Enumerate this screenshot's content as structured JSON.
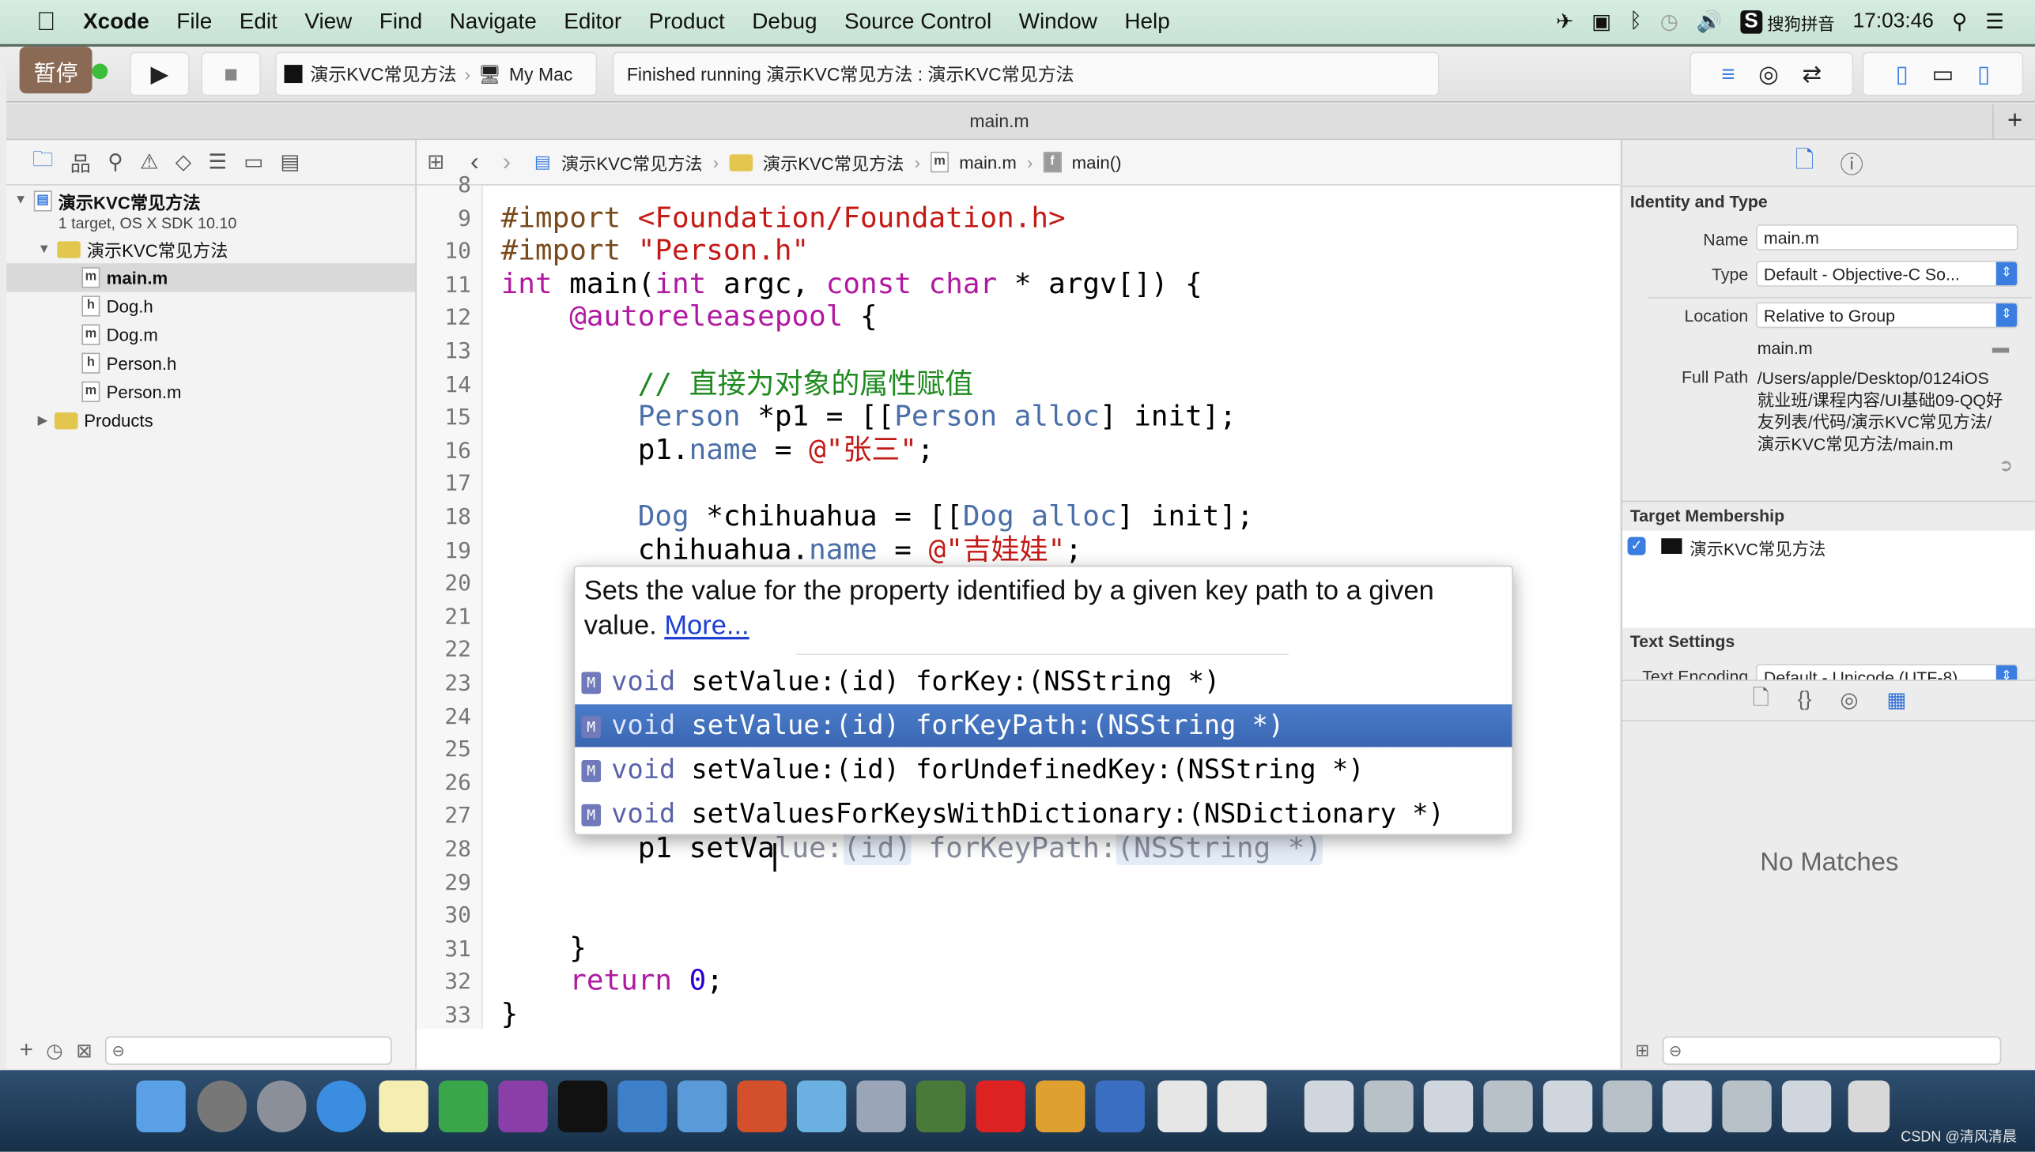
{
  "menubar": {
    "apple": "",
    "items": [
      "Xcode",
      "File",
      "Edit",
      "View",
      "Find",
      "Navigate",
      "Editor",
      "Product",
      "Debug",
      "Source Control",
      "Window",
      "Help"
    ],
    "input_method": "搜狗拼音",
    "clock": "17:03:46"
  },
  "toolbar": {
    "pause_label": "暂停",
    "scheme": "演示KVC常见方法",
    "destination": "My Mac",
    "status": "Finished running 演示KVC常见方法 : 演示KVC常见方法"
  },
  "tab": {
    "title": "main.m",
    "add": "+"
  },
  "navigator": {
    "project": {
      "name": "演示KVC常见方法",
      "subtitle": "1 target, OS X SDK 10.10"
    },
    "group": "演示KVC常见方法",
    "files": [
      {
        "badge": "m",
        "name": "main.m"
      },
      {
        "badge": "h",
        "name": "Dog.h"
      },
      {
        "badge": "m",
        "name": "Dog.m"
      },
      {
        "badge": "h",
        "name": "Person.h"
      },
      {
        "badge": "m",
        "name": "Person.m"
      }
    ],
    "products": "Products",
    "add": "+"
  },
  "jumpbar": {
    "crumbs": [
      "演示KVC常见方法",
      "演示KVC常见方法",
      "main.m",
      "main()"
    ]
  },
  "editor": {
    "lines": [
      {
        "n": "8",
        "tokens": []
      },
      {
        "n": "9",
        "tokens": [
          {
            "t": "#import ",
            "c": "pp"
          },
          {
            "t": "<Foundation/Foundation.h>",
            "c": "inc"
          }
        ]
      },
      {
        "n": "10",
        "tokens": [
          {
            "t": "#import ",
            "c": "pp"
          },
          {
            "t": "\"Person.h\"",
            "c": "inc"
          }
        ]
      },
      {
        "n": "11",
        "tokens": [
          {
            "t": "int",
            "c": "kw"
          },
          {
            "t": " main(",
            "c": ""
          },
          {
            "t": "int",
            "c": "kw"
          },
          {
            "t": " argc, ",
            "c": ""
          },
          {
            "t": "const",
            "c": "kw"
          },
          {
            "t": " ",
            "c": ""
          },
          {
            "t": "char",
            "c": "kw"
          },
          {
            "t": " * argv[]) {",
            "c": ""
          }
        ]
      },
      {
        "n": "12",
        "tokens": [
          {
            "t": "    ",
            "c": ""
          },
          {
            "t": "@autoreleasepool",
            "c": "kw"
          },
          {
            "t": " {",
            "c": ""
          }
        ]
      },
      {
        "n": "13",
        "tokens": []
      },
      {
        "n": "14",
        "tokens": [
          {
            "t": "        ",
            "c": ""
          },
          {
            "t": "// 直接为对象的属性赋值",
            "c": "cm"
          }
        ]
      },
      {
        "n": "15",
        "tokens": [
          {
            "t": "        ",
            "c": ""
          },
          {
            "t": "Person",
            "c": "ty"
          },
          {
            "t": " *p1 = [[",
            "c": ""
          },
          {
            "t": "Person",
            "c": "ty"
          },
          {
            "t": " ",
            "c": ""
          },
          {
            "t": "alloc",
            "c": "ty"
          },
          {
            "t": "] init];",
            "c": ""
          }
        ]
      },
      {
        "n": "16",
        "tokens": [
          {
            "t": "        p1.",
            "c": ""
          },
          {
            "t": "name",
            "c": "prop"
          },
          {
            "t": " = ",
            "c": ""
          },
          {
            "t": "@\"张三\"",
            "c": "str"
          },
          {
            "t": ";",
            "c": ""
          }
        ]
      },
      {
        "n": "17",
        "tokens": []
      },
      {
        "n": "18",
        "tokens": [
          {
            "t": "        ",
            "c": ""
          },
          {
            "t": "Dog",
            "c": "ty"
          },
          {
            "t": " *chihuahua = [[",
            "c": ""
          },
          {
            "t": "Dog",
            "c": "ty"
          },
          {
            "t": " ",
            "c": ""
          },
          {
            "t": "alloc",
            "c": "ty"
          },
          {
            "t": "] init];",
            "c": ""
          }
        ]
      },
      {
        "n": "19",
        "tokens": [
          {
            "t": "        chihuahua.",
            "c": ""
          },
          {
            "t": "name",
            "c": "prop"
          },
          {
            "t": " = ",
            "c": ""
          },
          {
            "t": "@\"吉娃娃\"",
            "c": "str"
          },
          {
            "t": ";",
            "c": ""
          }
        ]
      },
      {
        "n": "20",
        "tokens": []
      },
      {
        "n": "21",
        "tokens": []
      },
      {
        "n": "22",
        "tokens": []
      },
      {
        "n": "23",
        "tokens": []
      },
      {
        "n": "24",
        "tokens": []
      },
      {
        "n": "25",
        "tokens": []
      },
      {
        "n": "26",
        "tokens": []
      },
      {
        "n": "27",
        "tokens": []
      },
      {
        "n": "28",
        "tokens": [
          {
            "t": "        p1 setVa",
            "c": ""
          },
          {
            "t": "lue:",
            "c": "ph"
          },
          {
            "t": "(id)",
            "c": "phb"
          },
          {
            "t": " forKeyPath:",
            "c": "ph"
          },
          {
            "t": "(NSString *)",
            "c": "phb"
          }
        ]
      },
      {
        "n": "29",
        "tokens": []
      },
      {
        "n": "30",
        "tokens": []
      },
      {
        "n": "31",
        "tokens": [
          {
            "t": "    }",
            "c": ""
          }
        ]
      },
      {
        "n": "32",
        "tokens": [
          {
            "t": "    ",
            "c": ""
          },
          {
            "t": "return",
            "c": "kw"
          },
          {
            "t": " ",
            "c": ""
          },
          {
            "t": "0",
            "c": "num"
          },
          {
            "t": ";",
            "c": ""
          }
        ]
      },
      {
        "n": "33",
        "tokens": [
          {
            "t": "}",
            "c": ""
          }
        ]
      },
      {
        "n": "34",
        "tokens": []
      }
    ]
  },
  "completion": {
    "description": "Sets the value for the property identified by a given key path to a given value.",
    "more_link": "More...",
    "items": [
      {
        "badge": "M",
        "return_type": "void",
        "signature": "setValue:(id) forKey:(NSString *)",
        "selected": false
      },
      {
        "badge": "M",
        "return_type": "void",
        "signature": "setValue:(id) forKeyPath:(NSString *)",
        "selected": true
      },
      {
        "badge": "M",
        "return_type": "void",
        "signature": "setValue:(id) forUndefinedKey:(NSString *)",
        "selected": false
      },
      {
        "badge": "M",
        "return_type": "void",
        "signature": "setValuesForKeysWithDictionary:(NSDictionary *)",
        "selected": false
      }
    ]
  },
  "inspector": {
    "identity_title": "Identity and Type",
    "name_label": "Name",
    "name_value": "main.m",
    "type_label": "Type",
    "type_value": "Default - Objective-C So...",
    "location_label": "Location",
    "location_value": "Relative to Group",
    "relative_path": "main.m",
    "full_path_label": "Full Path",
    "full_path": "/Users/apple/Desktop/0124iOS就业班/课程内容/UI基础09-QQ好友列表/代码/演示KVC常见方法/演示KVC常见方法/main.m",
    "target_title": "Target Membership",
    "target_name": "演示KVC常见方法",
    "target_checked": true,
    "text_settings_title": "Text Settings",
    "text_encoding_label": "Text Encoding",
    "text_encoding_value": "Default - Unicode (UTF-8)",
    "library_empty": "No Matches"
  },
  "watermark": "CSDN @清风清晨",
  "colors": {
    "selection": "#3a66b2",
    "accent": "#3b7de0",
    "pause_bg": "#8a6a55"
  }
}
